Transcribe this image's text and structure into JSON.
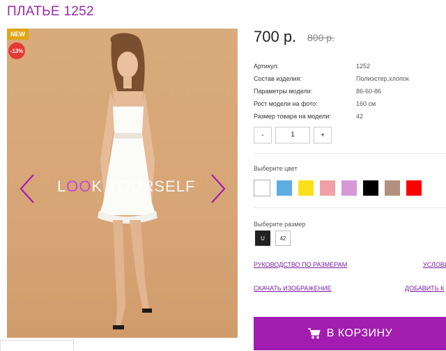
{
  "product": {
    "title": "ПЛАТЬЕ 1252",
    "badge_new": "NEW",
    "badge_sale": "-13%",
    "price": "700 р.",
    "old_price": "800 р.",
    "watermark_l": "L",
    "watermark_oo": "OO",
    "watermark_rest": "K YOURSELF"
  },
  "specs": [
    {
      "label": "Артикул:",
      "value": "1252"
    },
    {
      "label": "Состав изделия:",
      "value": "Полиэстер,хлопок"
    },
    {
      "label": "Параметры модели:",
      "value": "86-60-86"
    },
    {
      "label": "Рост модели на фото:",
      "value": "160 см"
    },
    {
      "label": "Размер товара на модели:",
      "value": "42"
    }
  ],
  "quantity": {
    "minus": "-",
    "value": "1",
    "plus": "+"
  },
  "color_section": {
    "label": "Выберите цвет",
    "swatches": [
      "#ffffff",
      "#5dade2",
      "#f9e01b",
      "#f1a1a6",
      "#d79ad6",
      "#000000",
      "#b39080",
      "#ff0000"
    ]
  },
  "size_section": {
    "label": "Выберите размер",
    "sizes": [
      "U",
      "42"
    ]
  },
  "links": {
    "size_guide": "РУКОВОДСТВО ПО РАЗМЕРАМ",
    "conditions": "УСЛОВИ",
    "download_image": "СКАЧАТЬ ИЗОБРАЖЕНИЕ",
    "add_to": "ДОБАВИТЬ К"
  },
  "cart": {
    "label": "В КОРЗИНУ"
  },
  "colors": {
    "accent": "#a21caf",
    "title": "#9c27b0",
    "sale": "#e53935",
    "new": "#e0a516"
  }
}
